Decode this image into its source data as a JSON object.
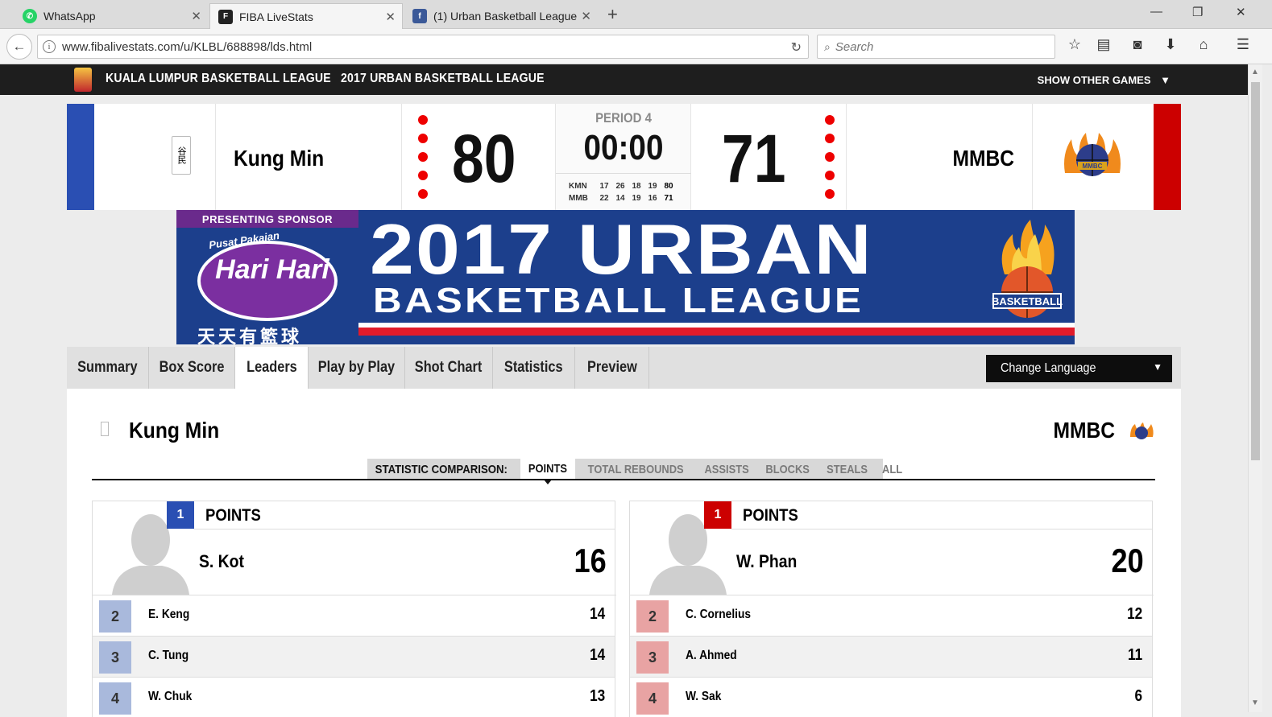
{
  "browser": {
    "tabs": [
      {
        "title": "WhatsApp",
        "icon": "whatsapp-icon",
        "color": "#25d366"
      },
      {
        "title": "FIBA LiveStats",
        "icon": "fiba-icon",
        "color": "#222222"
      },
      {
        "title": "(1) Urban Basketball League",
        "icon": "facebook-icon",
        "color": "#3b5998"
      }
    ],
    "url": "www.fibalivestats.com/u/KLBL/688898/lds.html",
    "search_placeholder": "Search"
  },
  "site": {
    "league": "KUALA LUMPUR BASKETBALL LEAGUE",
    "competition": "2017 URBAN BASKETBALL LEAGUE",
    "other_games": "SHOW OTHER GAMES"
  },
  "scoreboard": {
    "home": {
      "name": "Kung Min",
      "score": "80",
      "color": "#2a4fb3",
      "logo_text": "谷民"
    },
    "away": {
      "name": "MMBC",
      "score": "71",
      "color": "#cc0000"
    },
    "period": "PERIOD 4",
    "clock": "00:00",
    "quarters": [
      {
        "team": "KMN",
        "q": [
          "17",
          "26",
          "18",
          "19"
        ],
        "total": "80"
      },
      {
        "team": "MMB",
        "q": [
          "22",
          "14",
          "19",
          "16"
        ],
        "total": "71"
      }
    ]
  },
  "banner": {
    "sponsor_tag": "PRESENTING SPONSOR",
    "sponsor_top": "Pusat Pakaian",
    "sponsor_name": "Hari Hari",
    "sponsor_cn": "天天有籃球",
    "line1": "2017 URBAN",
    "line2": "BASKETBALL LEAGUE",
    "emblem_text": "BASKETBALL"
  },
  "nav_tabs": [
    {
      "label": "Summary"
    },
    {
      "label": "Box Score"
    },
    {
      "label": "Leaders"
    },
    {
      "label": "Play by Play"
    },
    {
      "label": "Shot Chart"
    },
    {
      "label": "Statistics"
    },
    {
      "label": "Preview"
    }
  ],
  "active_tab": "Leaders",
  "language_label": "Change Language",
  "comparison": {
    "home_team": "Kung Min",
    "away_team": "MMBC",
    "label": "STATISTIC COMPARISON:",
    "options": [
      "POINTS",
      "TOTAL REBOUNDS",
      "ASSISTS",
      "BLOCKS",
      "STEALS",
      "ALL"
    ],
    "selected": "POINTS"
  },
  "leaders": {
    "home": {
      "stat": "POINTS",
      "top": {
        "rank": "1",
        "name": "S. Kot",
        "value": "16"
      },
      "rows": [
        {
          "rank": "2",
          "name": "E. Keng",
          "value": "14"
        },
        {
          "rank": "3",
          "name": "C. Tung",
          "value": "14"
        },
        {
          "rank": "4",
          "name": "W. Chuk",
          "value": "13"
        }
      ],
      "badge_color": "#2a4fb3",
      "row_badge_color": "#a9b9dc"
    },
    "away": {
      "stat": "POINTS",
      "top": {
        "rank": "1",
        "name": "W. Phan",
        "value": "20"
      },
      "rows": [
        {
          "rank": "2",
          "name": "C. Cornelius",
          "value": "12"
        },
        {
          "rank": "3",
          "name": "A. Ahmed",
          "value": "11"
        },
        {
          "rank": "4",
          "name": "W. Sak",
          "value": "6"
        }
      ],
      "badge_color": "#cc0000",
      "row_badge_color": "#e8a3a3"
    }
  }
}
